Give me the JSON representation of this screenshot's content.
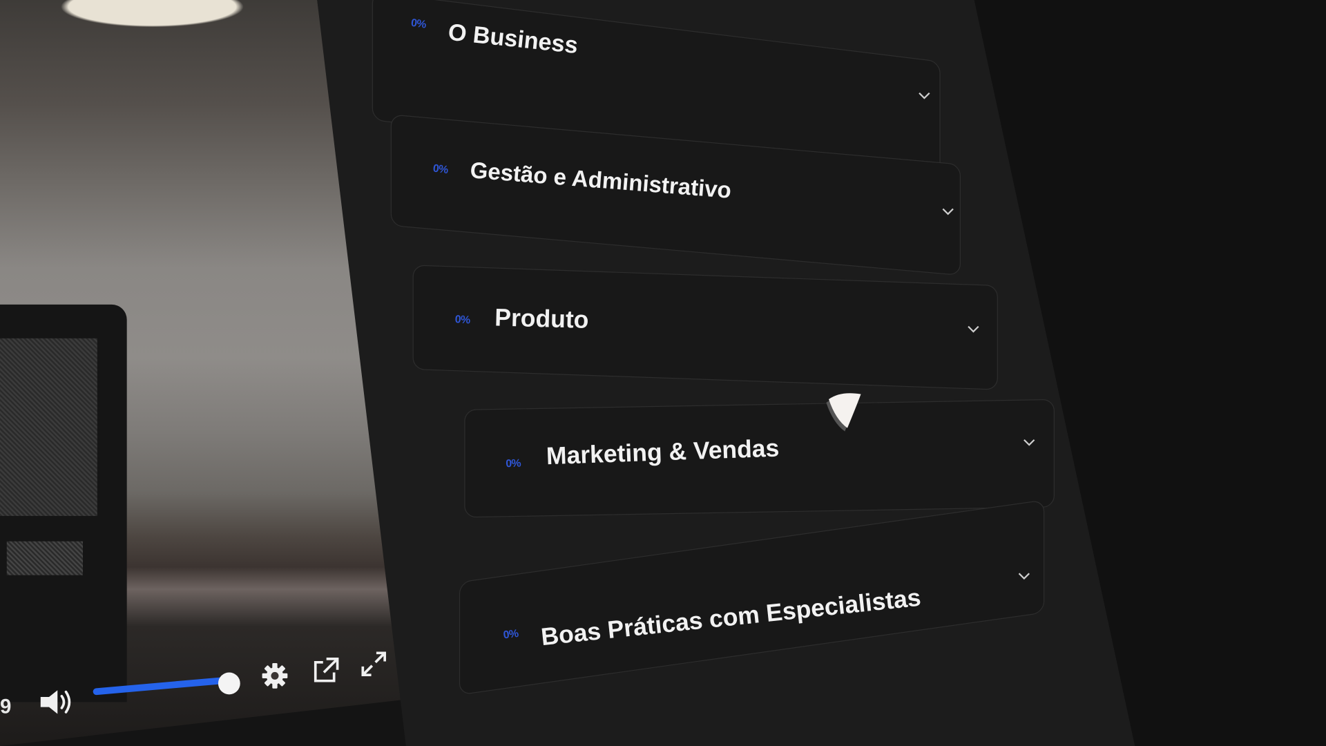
{
  "player": {
    "time_partial": "9",
    "volume_level_percent": 100,
    "icons": {
      "volume": "speaker-icon",
      "settings": "gear-icon",
      "popout": "external-link-icon",
      "fullscreen": "expand-icon"
    }
  },
  "modules": [
    {
      "progress": "0%",
      "title": "O Business"
    },
    {
      "progress": "0%",
      "title": "Gestão e Administrativo"
    },
    {
      "progress": "0%",
      "title": "Produto"
    },
    {
      "progress": "0%",
      "title": "Marketing & Vendas"
    },
    {
      "progress": "0%",
      "title": "Boas Práticas com Especialistas"
    }
  ],
  "colors": {
    "accent": "#2f56d6",
    "volume_bar": "#2563eb",
    "panel_bg": "#1c1c1c",
    "text": "#f2f2f2"
  }
}
